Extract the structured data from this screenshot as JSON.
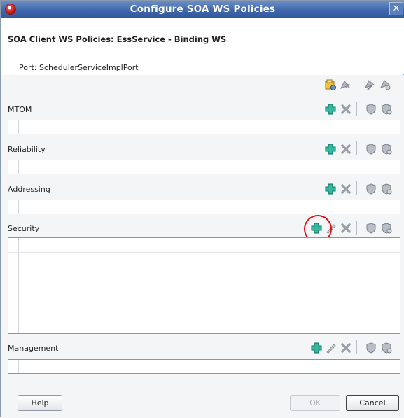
{
  "window": {
    "title": "Configure SOA WS Policies"
  },
  "header": {
    "title": "SOA Client WS Policies: EssService - Binding WS",
    "port": "Port: SchedulerServiceImplPort"
  },
  "sections": {
    "mtom": {
      "label": "MTOM"
    },
    "reliability": {
      "label": "Reliability"
    },
    "addressing": {
      "label": "Addressing"
    },
    "security": {
      "label": "Security"
    },
    "management": {
      "label": "Management"
    }
  },
  "buttons": {
    "help": "Help",
    "ok": "OK",
    "cancel": "Cancel"
  },
  "colors": {
    "titlebar": "#3f68ad",
    "add_icon": "#2aa18a",
    "highlight": "#e01010"
  }
}
